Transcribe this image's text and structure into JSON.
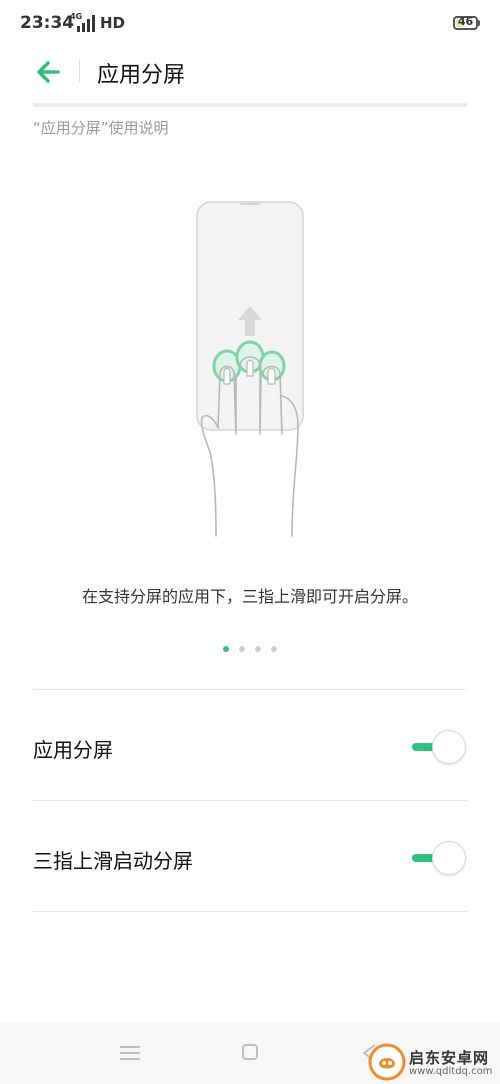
{
  "status_bar": {
    "time": "23:34",
    "network_small": "4G",
    "network": "HD",
    "battery_level": "46"
  },
  "header": {
    "title": "应用分屏"
  },
  "section": {
    "label": "“应用分屏”使用说明"
  },
  "tutorial": {
    "caption": "在支持分屏的应用下，三指上滑即可开启分屏。",
    "page_count": 4,
    "active_page": 1
  },
  "settings": [
    {
      "label": "应用分屏",
      "enabled": true
    },
    {
      "label": "三指上滑启动分屏",
      "enabled": true
    }
  ],
  "colors": {
    "accent": "#2ec27e"
  },
  "watermark": {
    "line1": "启东安卓网",
    "line2": "www.qdltdq.com"
  }
}
